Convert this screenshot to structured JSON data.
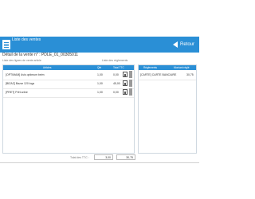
{
  "header": {
    "title": "Liste des ventes",
    "back_label": "Retour"
  },
  "subtitle": "Détail de la vente n° : PDLE_01_00305011",
  "labels": {
    "lines": "Liste des lignes de vente article",
    "payments": "Liste des règlements"
  },
  "lines_table": {
    "columns": [
      "Articles",
      "Qté",
      "Total TTC"
    ],
    "rows": [
      {
        "article": "[OPTIMAM] Avis optimum beim",
        "qty": "1,00",
        "total": "0,00"
      },
      {
        "article": "[BIZAZ] Bazar 120 logs",
        "qty": "1,00",
        "total": "45,00"
      },
      {
        "article": "[PRET] Prêt arbre",
        "qty": "1,00",
        "total": "0,00"
      }
    ]
  },
  "payments_table": {
    "columns": [
      "Règlements",
      "Montant réglé"
    ],
    "rows": [
      {
        "method": "[CARTE] CARTE BANCAIRE",
        "amount": "30,75"
      }
    ]
  },
  "totals": {
    "label": "Total des TTC :",
    "qty": "3,00",
    "amount": "30,75"
  }
}
